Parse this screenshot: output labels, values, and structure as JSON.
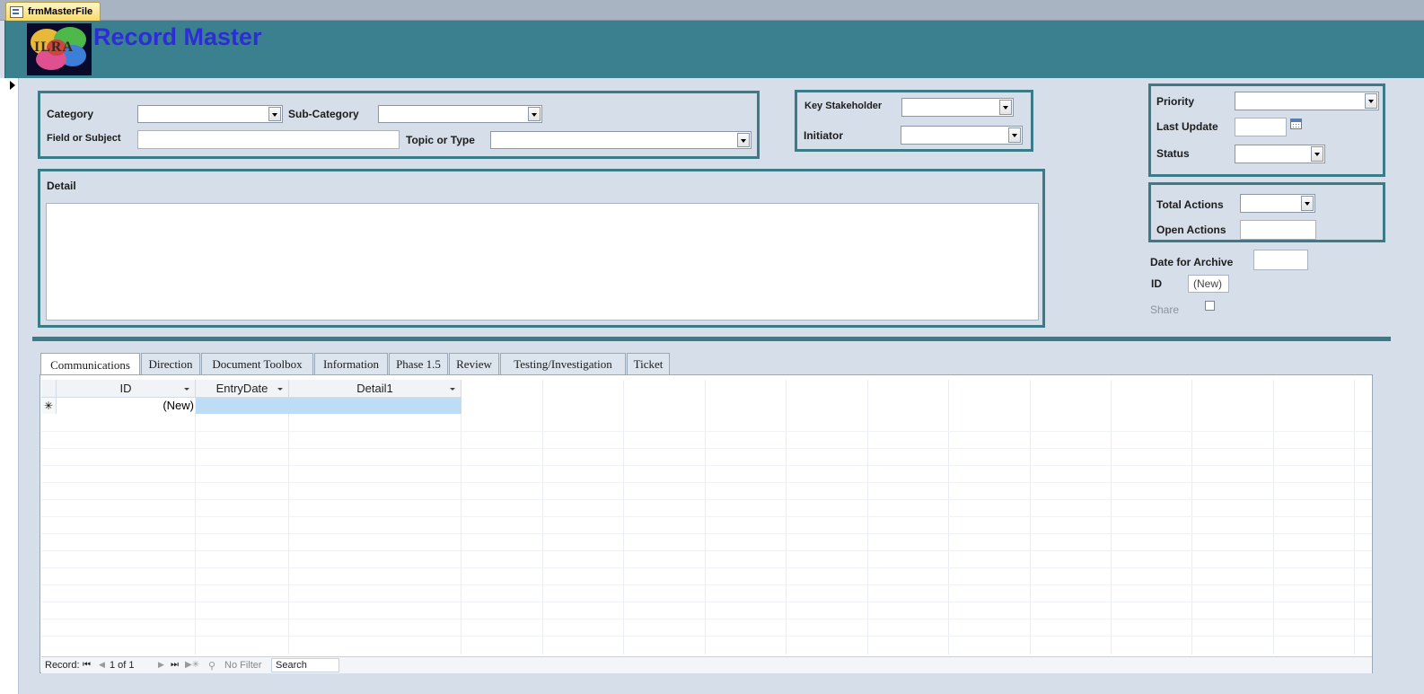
{
  "window": {
    "doc_tab": "frmMasterFile"
  },
  "header": {
    "title": "Record Master",
    "logo_text": "ILRA"
  },
  "classification": {
    "category_label": "Category",
    "category_value": "",
    "subcategory_label": "Sub-Category",
    "subcategory_value": "",
    "field_label": "Field or Subject",
    "field_value": "",
    "topic_label": "Topic or Type",
    "topic_value": ""
  },
  "people": {
    "stakeholder_label": "Key Stakeholder",
    "stakeholder_value": "",
    "initiator_label": "Initiator",
    "initiator_value": ""
  },
  "detail": {
    "label": "Detail",
    "value": ""
  },
  "status_box": {
    "priority_label": "Priority",
    "priority_value": "",
    "last_update_label": "Last Update",
    "last_update_value": "",
    "status_label": "Status",
    "status_value": ""
  },
  "actions_box": {
    "total_label": "Total Actions",
    "total_value": "",
    "open_label": "Open Actions",
    "open_value": ""
  },
  "misc": {
    "archive_label": "Date for Archive",
    "archive_value": "",
    "id_label": "ID",
    "id_value": "(New)",
    "share_label": "Share",
    "share_checked": false
  },
  "tabs": [
    {
      "label": "Communications",
      "active": true
    },
    {
      "label": "Direction"
    },
    {
      "label": "Document Toolbox"
    },
    {
      "label": "Information"
    },
    {
      "label": "Phase 1.5"
    },
    {
      "label": "Review"
    },
    {
      "label": "Testing/Investigation"
    },
    {
      "label": "Ticket"
    }
  ],
  "datasheet": {
    "columns": [
      "ID",
      "EntryDate",
      "Detail1"
    ],
    "new_row": {
      "marker": "✳",
      "id": "(New)",
      "entry_date": "",
      "detail1": ""
    }
  },
  "navbar": {
    "record_label": "Record:",
    "position": "1 of 1",
    "filter_label": "No Filter",
    "search_label": "Search"
  },
  "colors": {
    "header_band": "#3a808f",
    "group_border": "#3b7b88",
    "title": "#2d2dd6"
  }
}
